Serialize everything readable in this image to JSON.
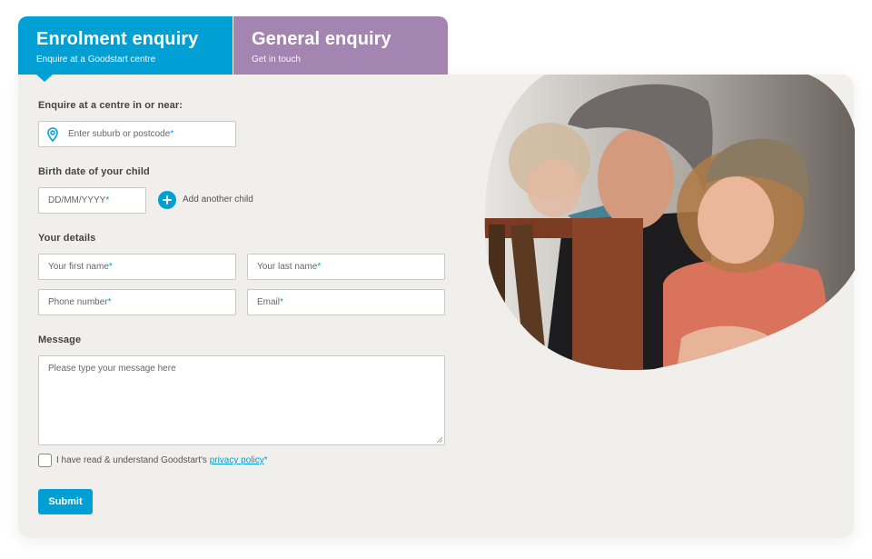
{
  "tabs": [
    {
      "title": "Enrolment enquiry",
      "subtitle": "Enquire at a Goodstart centre",
      "active": true,
      "color": "#00a0d4"
    },
    {
      "title": "General enquiry",
      "subtitle": "Get in touch",
      "active": false,
      "color": "#a484b0"
    }
  ],
  "form": {
    "location": {
      "label": "Enquire at a centre in or near:",
      "placeholder": "Enter suburb or postcode",
      "required_mark": "*",
      "icon": "location-pin-icon"
    },
    "birthdate": {
      "label": "Birth date of your child",
      "placeholder": "DD/MM/YYYY",
      "required_mark": "*",
      "add_child_label": "Add another child",
      "add_icon": "plus-circle-icon"
    },
    "details": {
      "label": "Your details",
      "first_name": "Your first name",
      "last_name": "Your last name",
      "phone": "Phone number",
      "email": "Email",
      "required_mark": "*"
    },
    "message": {
      "label": "Message",
      "placeholder": "Please type your message here"
    },
    "consent": {
      "text": "I have read & understand Goodstart's ",
      "link": "privacy policy",
      "required_mark": "*",
      "checked": false
    },
    "submit_label": "Submit"
  },
  "photo": {
    "description": "Father in bucket hat with curly-haired daughter in hat and pink shirt, child blurred in background"
  },
  "colors": {
    "accent": "#00a0d4",
    "secondary": "#a484b0",
    "card_bg": "#f0efec"
  }
}
